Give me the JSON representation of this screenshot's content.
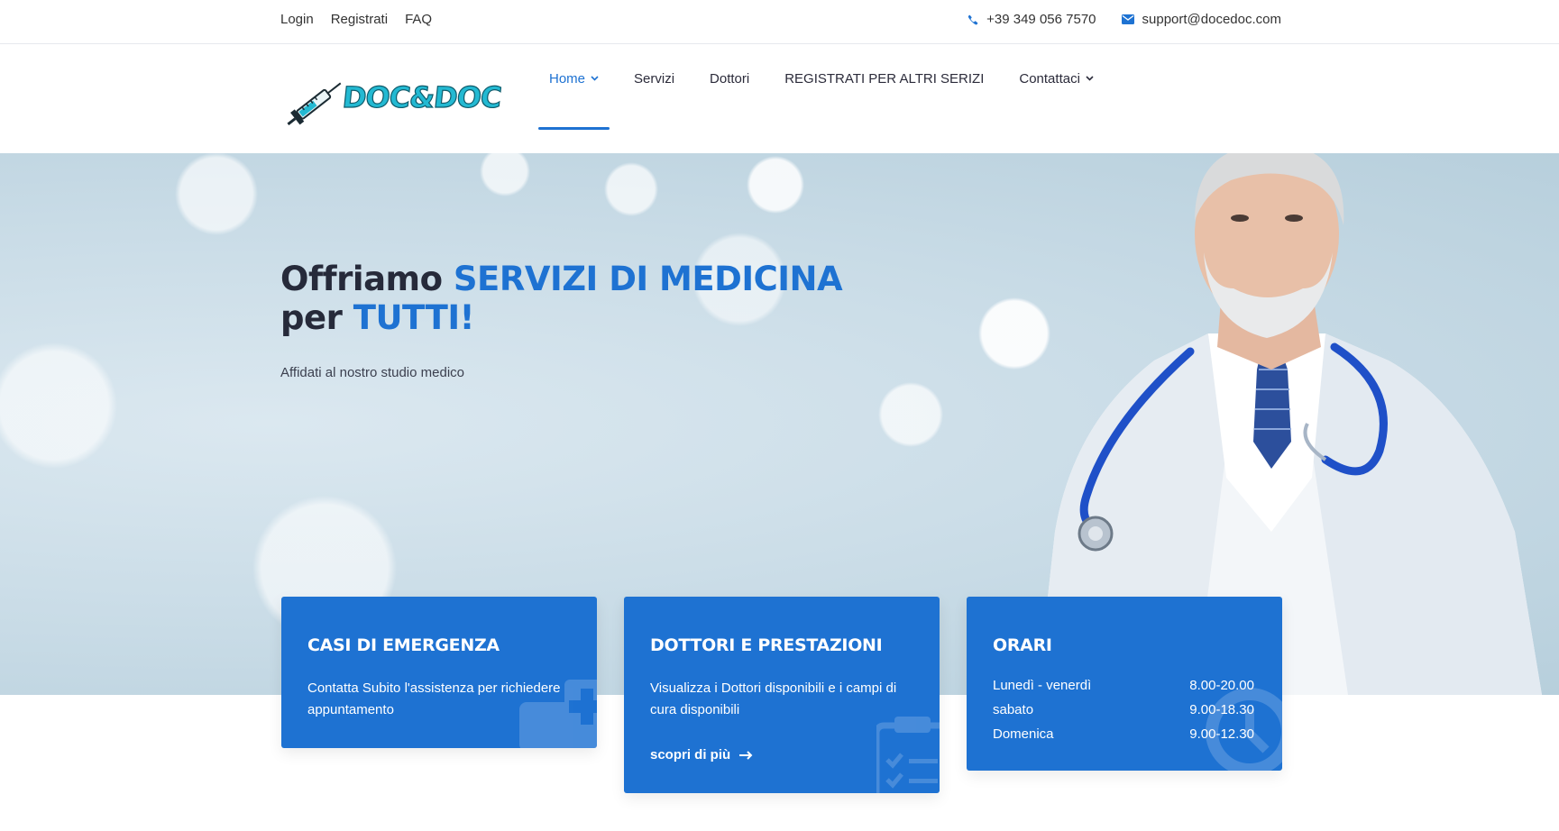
{
  "topbar": {
    "links": [
      "Login",
      "Registrati",
      "FAQ"
    ],
    "phone": "+39 349 056 7570",
    "email": "support@docedoc.com"
  },
  "header": {
    "logo_text": "DOC&DOC",
    "nav": [
      {
        "label": "Home",
        "active": true,
        "dropdown": true
      },
      {
        "label": "Servizi",
        "active": false,
        "dropdown": false
      },
      {
        "label": "Dottori",
        "active": false,
        "dropdown": false
      },
      {
        "label": "REGISTRATI PER ALTRI SERIZI",
        "active": false,
        "dropdown": false
      },
      {
        "label": "Contattaci",
        "active": false,
        "dropdown": true
      }
    ]
  },
  "hero": {
    "title_part1": "Offriamo ",
    "title_highlight1": "SERVIZI DI MEDICINA",
    "title_part2": "per ",
    "title_highlight2": "TUTTI!",
    "subtitle": "Affidati al nostro studio medico"
  },
  "cards": {
    "emergency": {
      "title": "CASI DI EMERGENZA",
      "text": "Contatta Subito l'assistenza per richiedere appuntamento",
      "icon": "ambulance-icon"
    },
    "doctors": {
      "title": "DOTTORI E PRESTAZIONI",
      "text": "Visualizza i Dottori disponibili e i campi di cura disponibili",
      "link": "scopri di più",
      "icon": "clipboard-icon"
    },
    "hours": {
      "title": "ORARI",
      "rows": [
        {
          "day": "Lunedì - venerdì",
          "time": "8.00-20.00"
        },
        {
          "day": "sabato",
          "time": "9.00-18.30"
        },
        {
          "day": "Domenica",
          "time": "9.00-12.30"
        }
      ],
      "icon": "clock-icon"
    }
  },
  "colors": {
    "primary": "#1e72d2",
    "text_dark": "#262a3a",
    "logo": "#23b9d2"
  }
}
